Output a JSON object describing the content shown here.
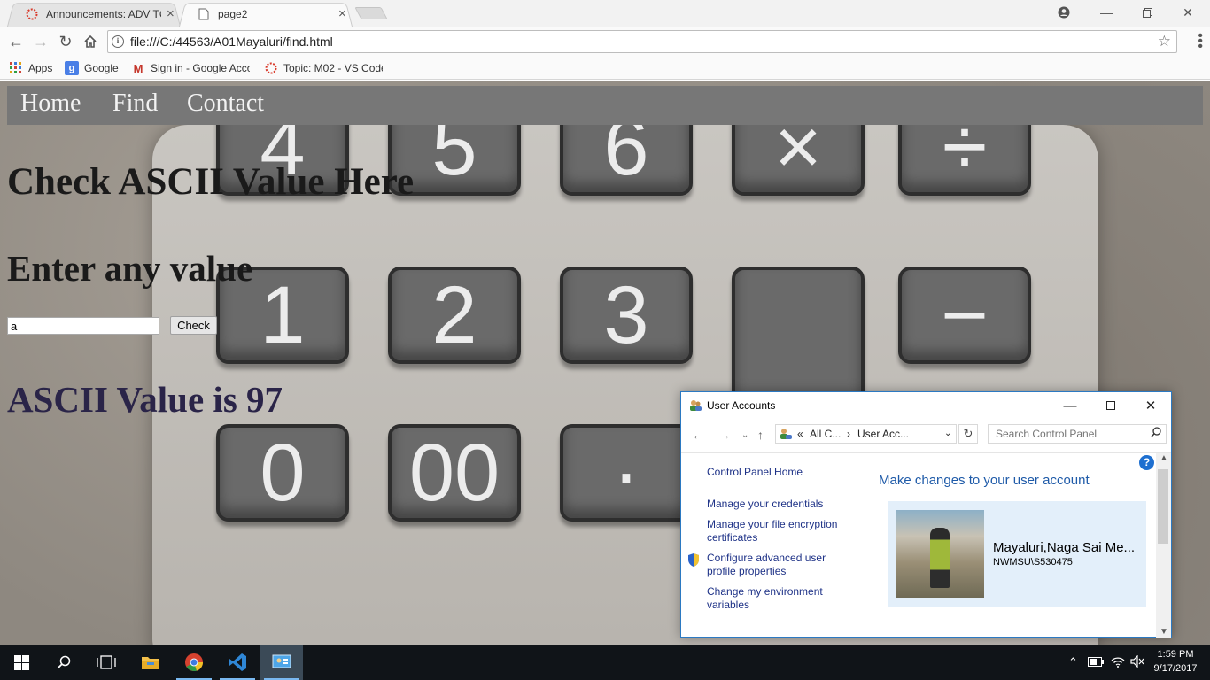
{
  "browser": {
    "tabs": [
      {
        "label": "Announcements: ADV TC",
        "close": "×",
        "active": false
      },
      {
        "label": "page2",
        "close": "×",
        "active": true
      }
    ],
    "url": "file:///C:/44563/A01Mayaluri/find.html",
    "bookmarks": [
      {
        "label": "Apps",
        "icon": "apps-grid-icon"
      },
      {
        "label": "Google",
        "icon": "google-icon"
      },
      {
        "label": "Sign in - Google Acco",
        "icon": "gmail-icon"
      },
      {
        "label": "Topic: M02 - VS Code",
        "icon": "canvas-icon"
      }
    ]
  },
  "page": {
    "nav": [
      "Home",
      "Find",
      "Contact"
    ],
    "heading": "Check ASCII Value Here",
    "subheading": "Enter any value",
    "input_value": "a",
    "button_label": "Check",
    "result": "ASCII Value is 97",
    "calculator_keys": [
      "4",
      "5",
      "6",
      "×",
      "÷",
      "1",
      "2",
      "3",
      "",
      "−",
      "0",
      "00",
      "·",
      ""
    ]
  },
  "user_accounts": {
    "title": "User Accounts",
    "breadcrumb": [
      "All C...",
      "User Acc..."
    ],
    "search_placeholder": "Search Control Panel",
    "links": [
      "Control Panel Home",
      "Manage your credentials",
      "Manage your file encryption certificates",
      "Configure advanced user profile properties",
      "Change my environment variables"
    ],
    "heading": "Make changes to your user account",
    "account_name": "Mayaluri,Naga Sai Me...",
    "account_domain": "NWMSU\\S530475"
  },
  "taskbar": {
    "time": "1:59 PM",
    "date": "9/17/2017"
  },
  "colors": {
    "nav_bar": "#777777",
    "result_text": "#2a2448",
    "window_border": "#2b79c2",
    "link": "#1e3287"
  }
}
